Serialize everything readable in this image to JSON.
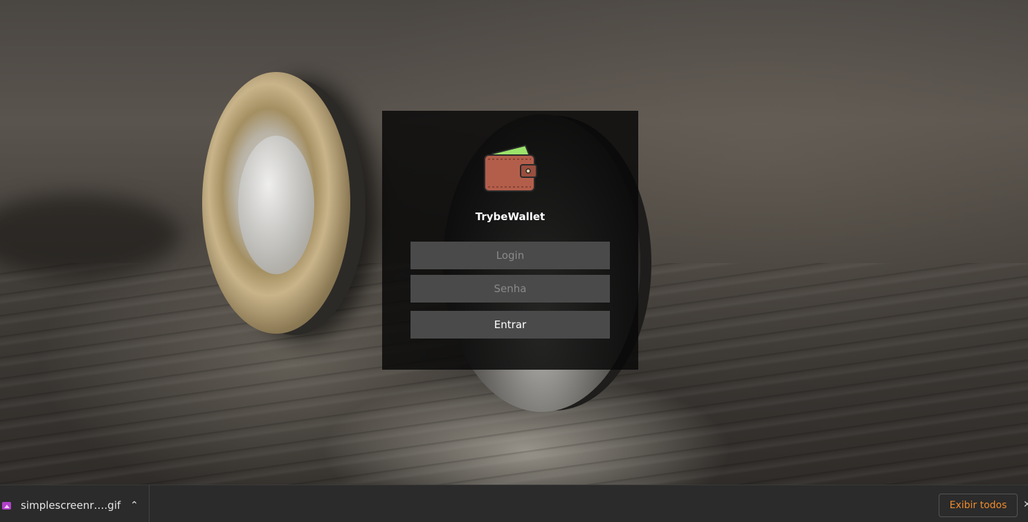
{
  "app": {
    "title": "TrybeWallet",
    "logo_icon": "wallet-icon"
  },
  "login_form": {
    "email_placeholder": "Login",
    "password_placeholder": "Senha",
    "submit_label": "Entrar"
  },
  "download_bar": {
    "file_name": "simplescreenr….gif",
    "file_icon": "image-file-icon",
    "menu_icon": "chevron-up-icon",
    "show_all_label": "Exibir todos",
    "close_icon": "close-icon"
  },
  "colors": {
    "card_background": "#080808",
    "field_background": "#4a4a4a",
    "wallet_body": "#b35e4b",
    "wallet_note": "#9be36b",
    "accent_orange": "#f08a2c",
    "download_bar": "#2b2b2b"
  }
}
